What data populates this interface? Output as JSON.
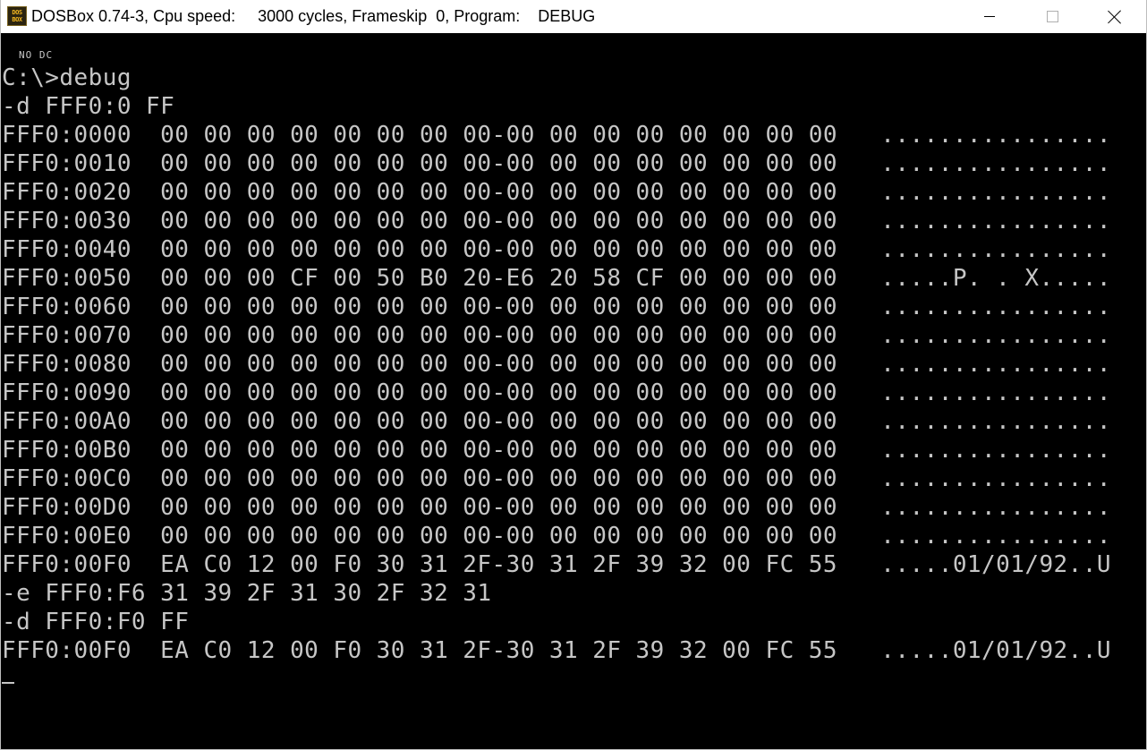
{
  "window": {
    "title": "DOSBox 0.74-3, Cpu speed:     3000 cycles, Frameskip  0, Program:    DEBUG",
    "icon_label_top": "DOS",
    "icon_label_bottom": "BOX",
    "icon": "dosbox-icon",
    "controls": {
      "minimize_icon": "minimize-icon",
      "maximize_icon": "maximize-icon",
      "close_icon": "close-icon"
    }
  },
  "screen": {
    "status_tag": "NO DC",
    "lines": [
      "C:\\>debug",
      "-d FFF0:0 FF",
      "FFF0:0000  00 00 00 00 00 00 00 00-00 00 00 00 00 00 00 00   ................",
      "FFF0:0010  00 00 00 00 00 00 00 00-00 00 00 00 00 00 00 00   ................",
      "FFF0:0020  00 00 00 00 00 00 00 00-00 00 00 00 00 00 00 00   ................",
      "FFF0:0030  00 00 00 00 00 00 00 00-00 00 00 00 00 00 00 00   ................",
      "FFF0:0040  00 00 00 00 00 00 00 00-00 00 00 00 00 00 00 00   ................",
      "FFF0:0050  00 00 00 CF 00 50 B0 20-E6 20 58 CF 00 00 00 00   .....P. . X.....",
      "FFF0:0060  00 00 00 00 00 00 00 00-00 00 00 00 00 00 00 00   ................",
      "FFF0:0070  00 00 00 00 00 00 00 00-00 00 00 00 00 00 00 00   ................",
      "FFF0:0080  00 00 00 00 00 00 00 00-00 00 00 00 00 00 00 00   ................",
      "FFF0:0090  00 00 00 00 00 00 00 00-00 00 00 00 00 00 00 00   ................",
      "FFF0:00A0  00 00 00 00 00 00 00 00-00 00 00 00 00 00 00 00   ................",
      "FFF0:00B0  00 00 00 00 00 00 00 00-00 00 00 00 00 00 00 00   ................",
      "FFF0:00C0  00 00 00 00 00 00 00 00-00 00 00 00 00 00 00 00   ................",
      "FFF0:00D0  00 00 00 00 00 00 00 00-00 00 00 00 00 00 00 00   ................",
      "FFF0:00E0  00 00 00 00 00 00 00 00-00 00 00 00 00 00 00 00   ................",
      "FFF0:00F0  EA C0 12 00 F0 30 31 2F-30 31 2F 39 32 00 FC 55   .....01/01/92..U",
      "-e FFF0:F6 31 39 2F 31 30 2F 32 31",
      "-d FFF0:F0 FF",
      "FFF0:00F0  EA C0 12 00 F0 30 31 2F-30 31 2F 39 32 00 FC 55   .....01/01/92..U"
    ]
  },
  "colors": {
    "terminal_bg": "#000000",
    "terminal_fg": "#c6c6c6",
    "titlebar_bg": "#ffffff"
  }
}
